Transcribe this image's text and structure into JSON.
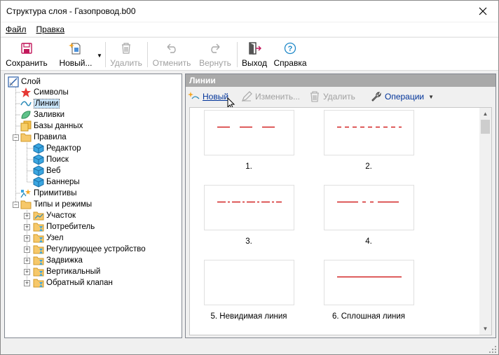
{
  "window": {
    "title": "Структура слоя - Газопровод.b00"
  },
  "menu": [
    {
      "label": "Файл"
    },
    {
      "label": "Правка"
    }
  ],
  "toolbar": {
    "save": "Сохранить",
    "new": "Новый...",
    "delete": "Удалить",
    "undo": "Отменить",
    "redo": "Вернуть",
    "exit": "Выход",
    "help": "Справка"
  },
  "tree": [
    {
      "label": "Слой",
      "icon": "layer-icon"
    },
    {
      "label": "Символы",
      "icon": "star-icon"
    },
    {
      "label": "Линии",
      "icon": "line-icon",
      "selected": true
    },
    {
      "label": "Заливки",
      "icon": "fill-icon"
    },
    {
      "label": "Базы данных",
      "icon": "database-icon"
    },
    {
      "label": "Правила",
      "icon": "folder-icon",
      "expanded": true
    },
    {
      "label": "Редактор",
      "icon": "cube-icon"
    },
    {
      "label": "Поиск",
      "icon": "cube-icon"
    },
    {
      "label": "Веб",
      "icon": "cube-icon"
    },
    {
      "label": "Баннеры",
      "icon": "cube-icon"
    },
    {
      "label": "Примитивы",
      "icon": "primitives-icon"
    },
    {
      "label": "Типы и режимы",
      "icon": "folder-icon",
      "expanded": true
    },
    {
      "label": "Участок",
      "icon": "type-folder-icon"
    },
    {
      "label": "Потребитель",
      "icon": "type-folder-icon"
    },
    {
      "label": "Узел",
      "icon": "type-folder-icon"
    },
    {
      "label": "Регулирующее устройство",
      "icon": "type-folder-icon"
    },
    {
      "label": "Задвижка",
      "icon": "type-folder-icon"
    },
    {
      "label": "Вертикальный",
      "icon": "type-folder-icon"
    },
    {
      "label": "Обратный клапан",
      "icon": "type-folder-icon"
    }
  ],
  "panel": {
    "header": "Линии",
    "new": "Новый",
    "edit": "Изменить...",
    "delete": "Удалить",
    "operations": "Операции"
  },
  "lines": [
    {
      "caption": "1.",
      "style": "long-dash"
    },
    {
      "caption": "2.",
      "style": "short-dash"
    },
    {
      "caption": "3.",
      "style": "dash-dot"
    },
    {
      "caption": "4.",
      "style": "long-dash-gap"
    },
    {
      "caption": "5. Невидимая линия",
      "style": "invisible"
    },
    {
      "caption": "6. Сплошная линия",
      "style": "solid"
    }
  ],
  "colors": {
    "line": "#cc0000",
    "header": "#a9a9a9",
    "link": "#003399",
    "selection": "#cce8ff"
  }
}
